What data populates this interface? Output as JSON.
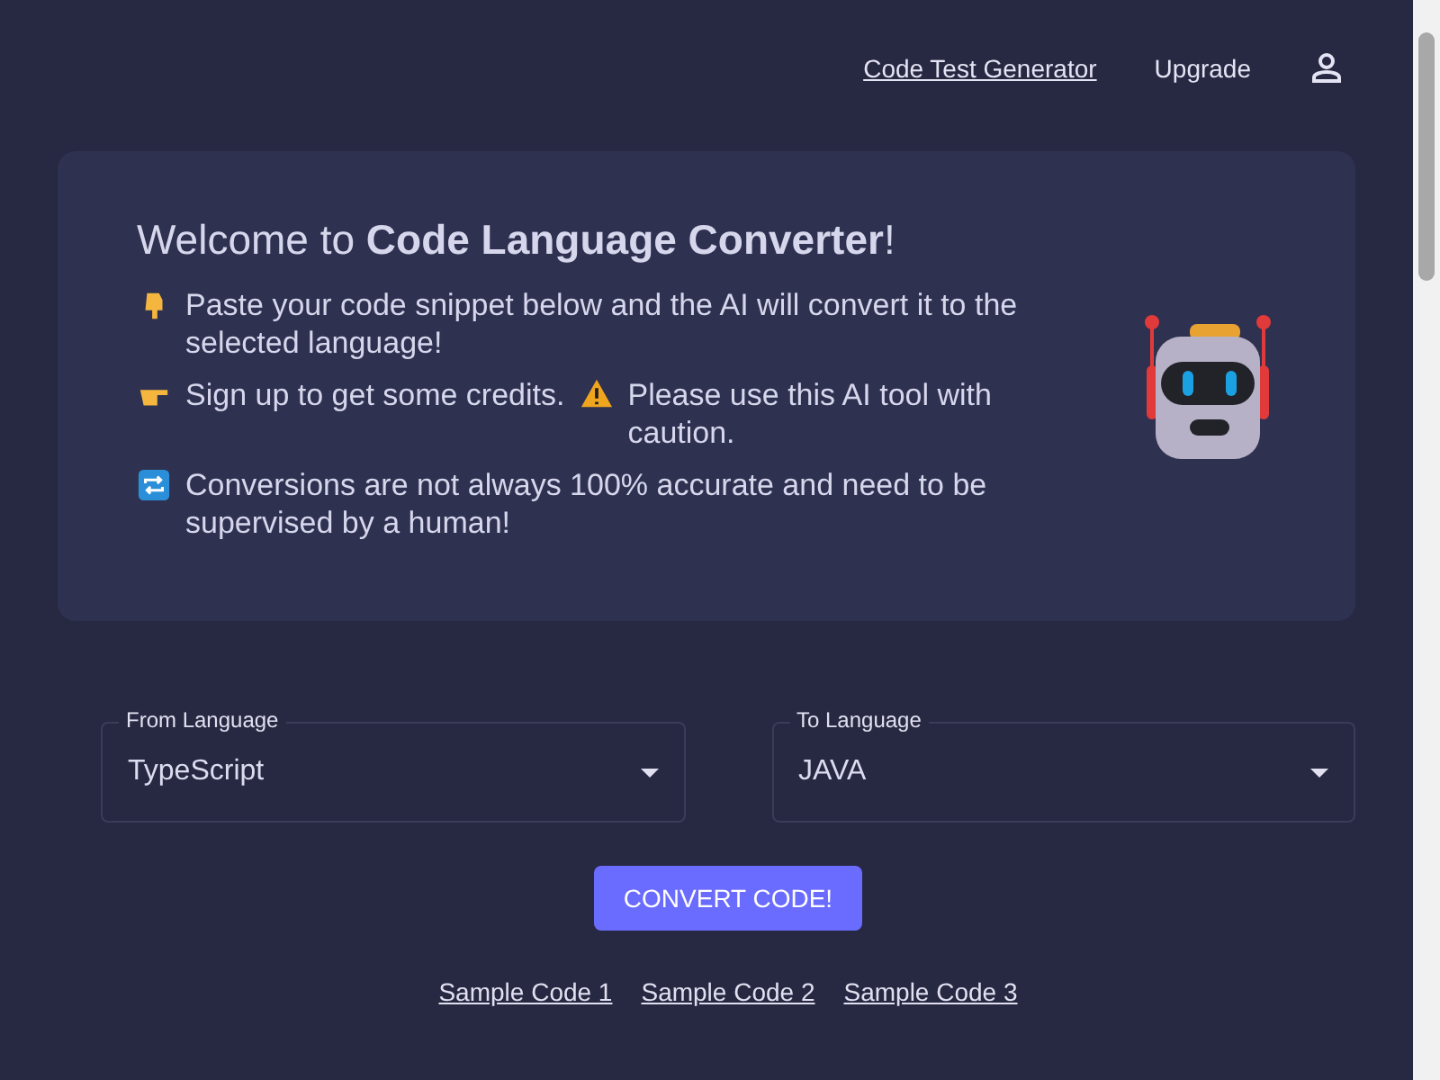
{
  "nav": {
    "links": [
      {
        "label": "Code Test Generator",
        "kind": "link"
      },
      {
        "label": "Upgrade",
        "kind": "plain"
      }
    ]
  },
  "welcome": {
    "title": "Welcome to **Code Language Converter**!",
    "lines": [
      {
        "parts": [
          "Paste your code snippet below and the AI will convert it to the selected language!"
        ]
      },
      {
        "parts": [
          "Sign up to get some credits.",
          "Please use this AI tool with caution."
        ]
      },
      {
        "parts": [
          "Conversions are not always 100% accurate and need to be supervised by a human!"
        ]
      }
    ]
  },
  "selects": [
    {
      "label": "From Language",
      "value": "TypeScript"
    },
    {
      "label": "To Language",
      "value": "JAVA"
    }
  ],
  "convert_button": "CONVERT CODE!",
  "samples": [
    "Sample Code 1",
    "Sample Code 2",
    "Sample Code 3"
  ]
}
